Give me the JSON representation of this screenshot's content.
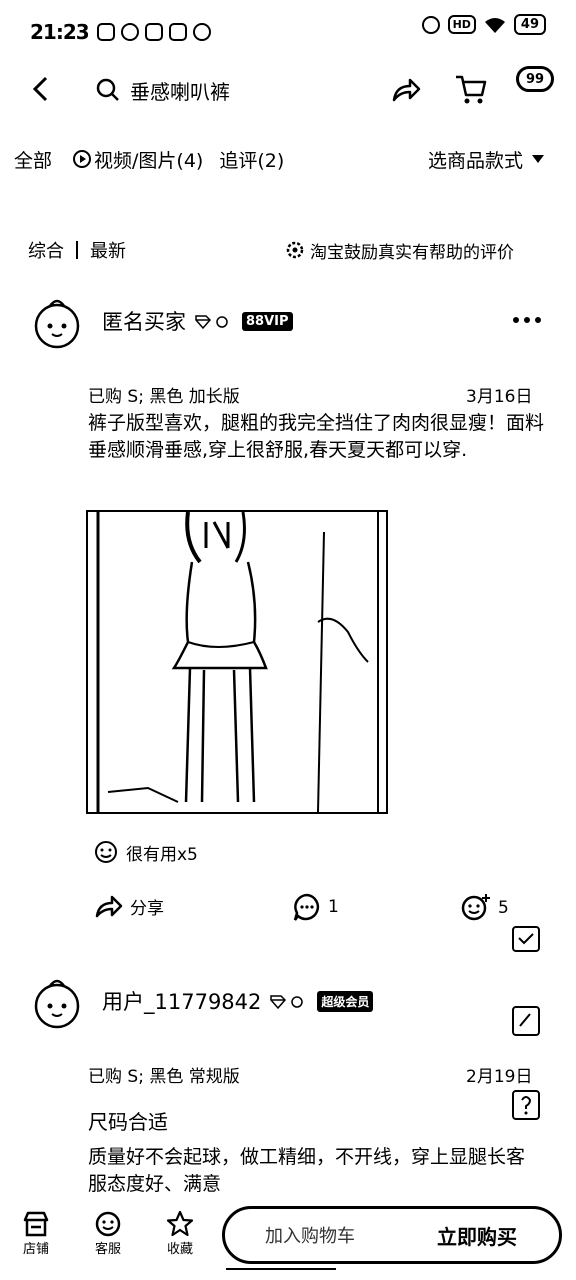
{
  "status_bar": {
    "time": "21:23",
    "hd": "HD",
    "battery": "49"
  },
  "header": {
    "search_text": "垂感喇叭裤",
    "more_badge": "99"
  },
  "filters": {
    "all": "全部",
    "media": "视频/图片(4)",
    "followup": "追评(2)",
    "select_style": "选商品款式"
  },
  "sort": {
    "comprehensive": "综合",
    "latest": "最新",
    "encourage": "淘宝鼓励真实有帮助的评价"
  },
  "reviews": [
    {
      "username": "匿名买家",
      "badge": "88VIP",
      "purchased": "已购 S; 黑色 加长版",
      "date": "3月16日",
      "text": "裤子版型喜欢，腿粗的我完全挡住了肉肉很显瘦！面料垂感顺滑垂感,穿上很舒服,春天夏天都可以穿.",
      "useful": "很有用x5",
      "share": "分享",
      "comments": "1",
      "likes": "5"
    },
    {
      "username": "用户_11779842",
      "badge": "超级会员",
      "purchased": "已购 S; 黑色 常规版",
      "date": "2月19日",
      "title": "尺码合适",
      "text": "质量好不会起球，做工精细，不开线，穿上显腿长客服态度好、满意"
    }
  ],
  "bottom_bar": {
    "shop": "店铺",
    "service": "客服",
    "favorite": "收藏",
    "cart": "加入购物车",
    "buy": "立即购买"
  }
}
